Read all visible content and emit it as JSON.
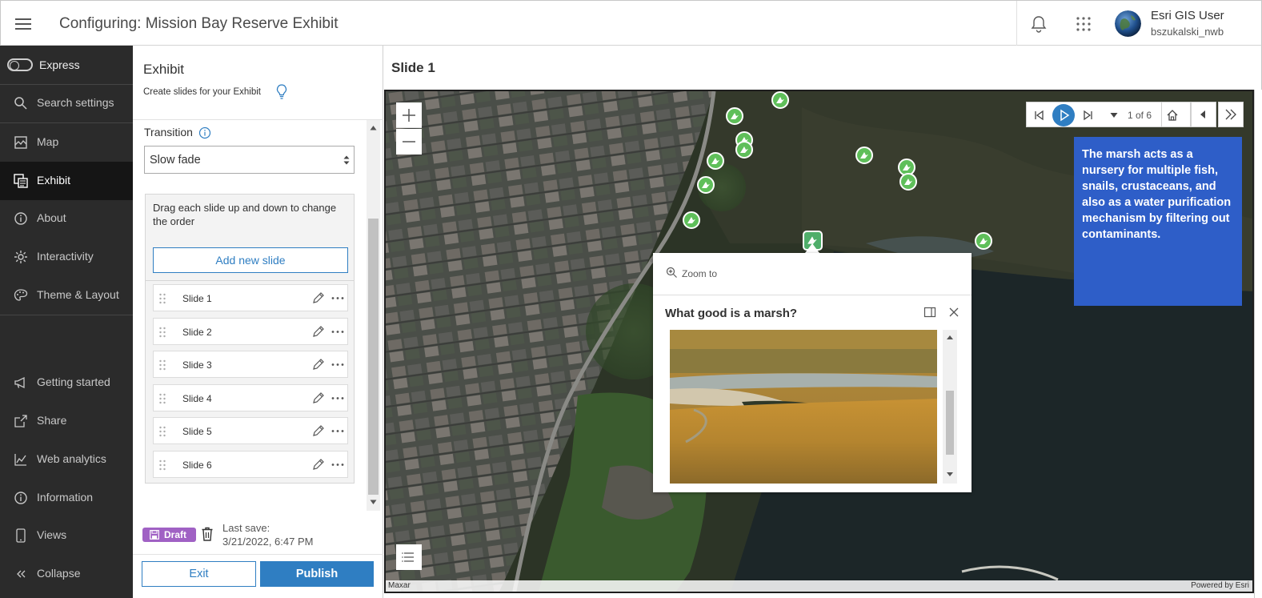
{
  "header": {
    "title": "Configuring: Mission Bay Reserve Exhibit",
    "user_name": "Esri GIS User",
    "user_id": "bszukalski_nwb"
  },
  "nav": {
    "express_label": "Express",
    "items": [
      {
        "label": "Search settings",
        "icon": "search-icon"
      },
      {
        "label": "Map",
        "icon": "map-icon"
      },
      {
        "label": "Exhibit",
        "icon": "exhibit-icon"
      },
      {
        "label": "About",
        "icon": "info-icon"
      },
      {
        "label": "Interactivity",
        "icon": "gear-icon"
      },
      {
        "label": "Theme & Layout",
        "icon": "palette-icon"
      },
      {
        "label": "Getting started",
        "icon": "megaphone-icon"
      },
      {
        "label": "Share",
        "icon": "share-icon"
      },
      {
        "label": "Web analytics",
        "icon": "chart-icon"
      },
      {
        "label": "Information",
        "icon": "info-icon"
      },
      {
        "label": "Views",
        "icon": "phone-icon"
      },
      {
        "label": "Collapse",
        "icon": "chevrons-left-icon"
      }
    ],
    "active": "Exhibit"
  },
  "panel": {
    "title": "Exhibit",
    "subtitle": "Create slides for your Exhibit",
    "transition_label": "Transition",
    "transition_value": "Slow fade",
    "drag_hint": "Drag each slide up and down to change the order",
    "add_slide_label": "Add new slide",
    "slides": [
      "Slide 1",
      "Slide 2",
      "Slide 3",
      "Slide 4",
      "Slide 5",
      "Slide 6"
    ],
    "draft_label": "Draft",
    "last_save_label": "Last save:",
    "last_save_value": "3/21/2022, 6:47 PM",
    "exit_label": "Exit",
    "publish_label": "Publish"
  },
  "main": {
    "title": "Slide 1",
    "player_count": "1 of 6",
    "caption": "The marsh acts as a nursery for multiple fish, snails, crustaceans, and also as a water purification mechanism by filtering out contaminants.",
    "popup": {
      "zoom_label": "Zoom to",
      "title": "What good is a marsh?"
    },
    "attribution_left": "Maxar",
    "attribution_right": "Powered by Esri"
  },
  "colors": {
    "accent": "#2f7ec2",
    "caption_bg": "#2e5ec8",
    "draft_badge": "#a061c4",
    "nav_bg": "#2b2b2b",
    "marker": "#5fbf5a"
  }
}
